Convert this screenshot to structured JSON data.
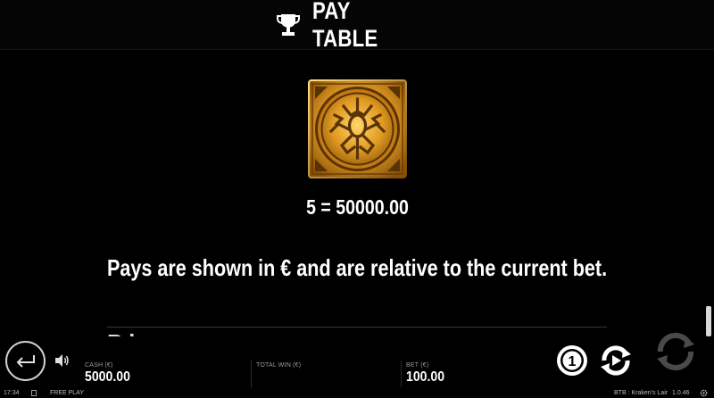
{
  "header": {
    "title": "PAY TABLE",
    "icon": "trophy-icon"
  },
  "symbol": {
    "icon": "kraken-emblem-icon",
    "pay_line": "5 = 50000.00"
  },
  "info_text": "Pays are shown in € and are relative to the current bet.",
  "partial_heading": "P    l",
  "footer": {
    "cash_label": "CASH (€)",
    "cash_value": "5000.00",
    "total_win_label": "TOTAL WIN (€)",
    "bet_label": "BET (€)",
    "bet_value": "100.00"
  },
  "status_bar": {
    "time": "17:34",
    "mode": "FREE PLAY",
    "game": "BTB : Kraken's Lair",
    "version": "1.0.46"
  },
  "colors": {
    "gold": "#e0a22a",
    "gold_dark": "#7a4a08",
    "background": "#000000"
  }
}
